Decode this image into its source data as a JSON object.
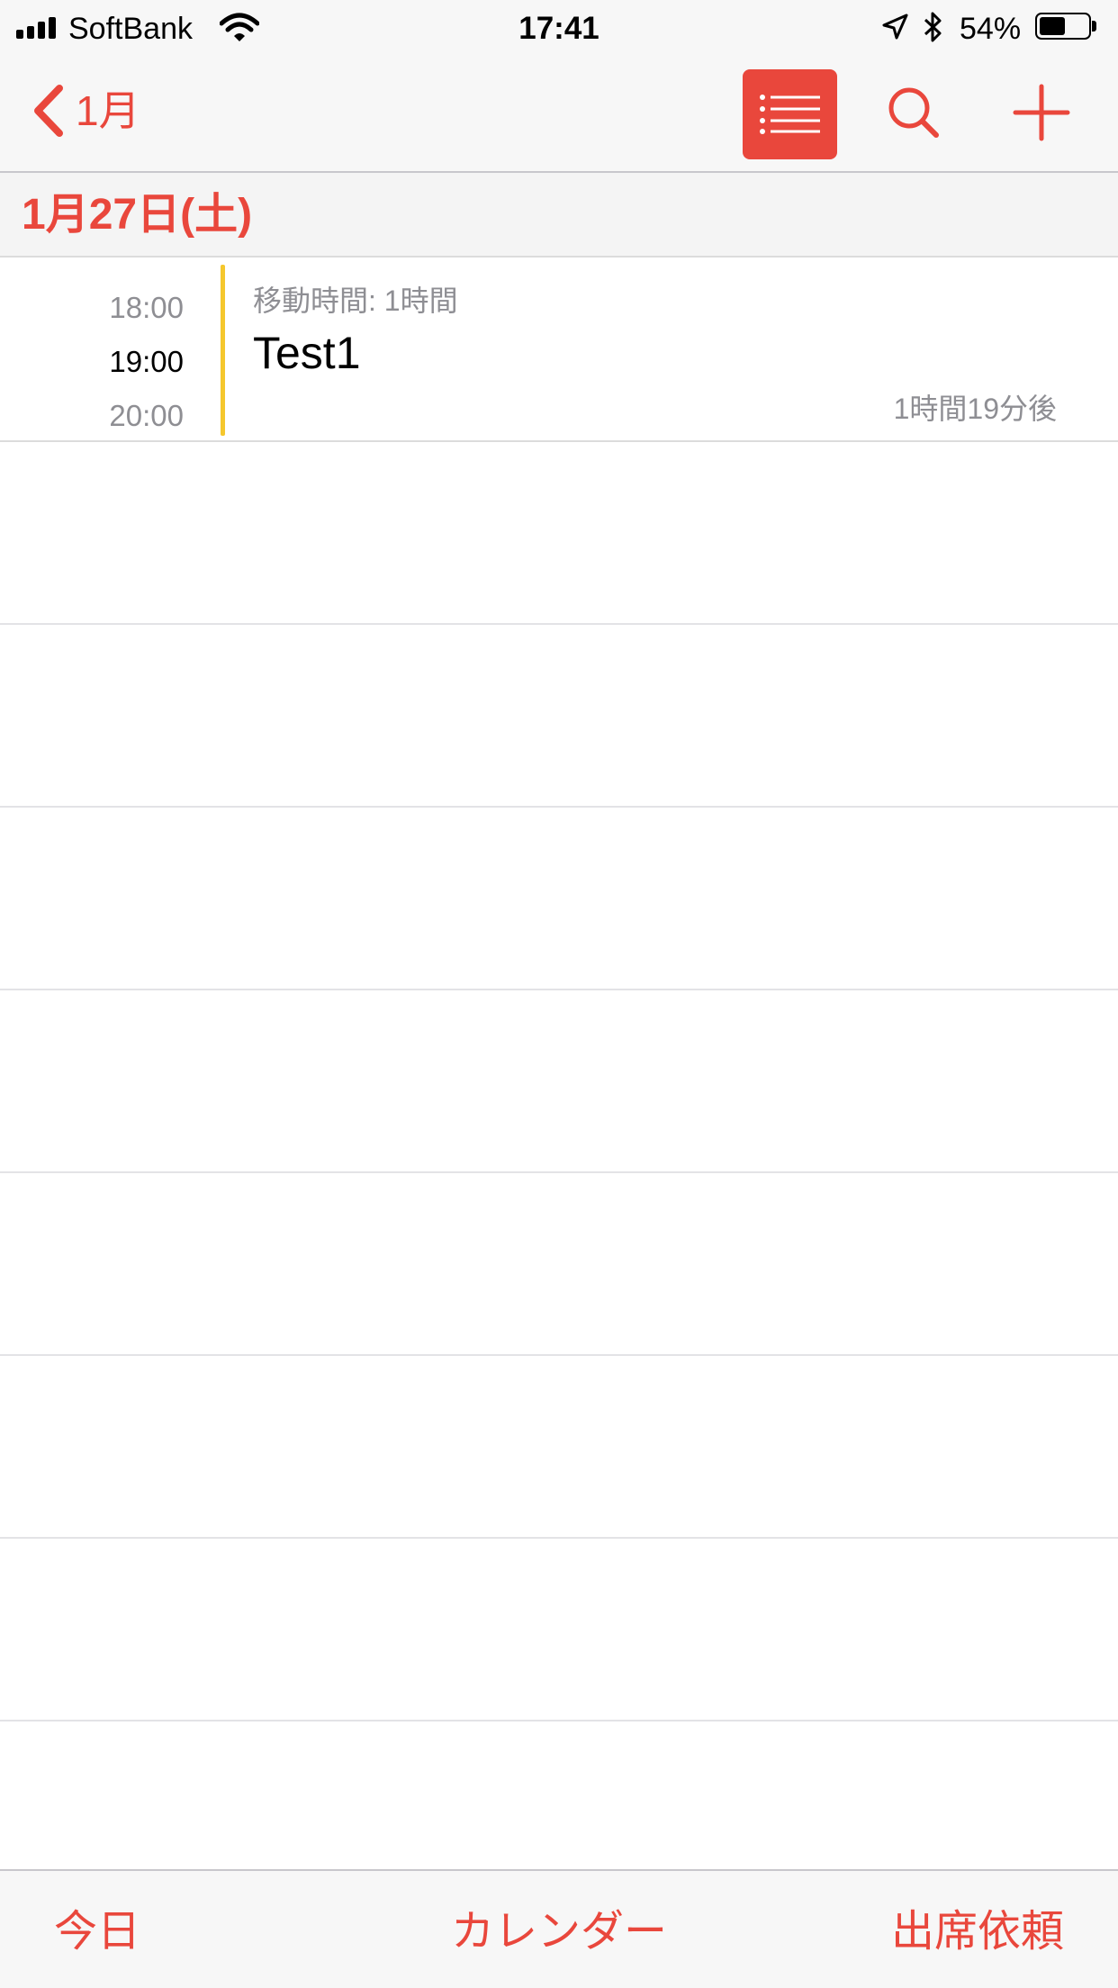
{
  "status_bar": {
    "carrier": "SoftBank",
    "time": "17:41",
    "battery_percent": "54%",
    "battery_level": 0.54,
    "icons": [
      "signal-icon",
      "wifi-icon",
      "location-icon",
      "bluetooth-icon",
      "battery-icon"
    ]
  },
  "nav": {
    "back_label": "1月",
    "icons": [
      "chevron-left-icon",
      "list-icon",
      "search-icon",
      "plus-icon"
    ]
  },
  "section": {
    "date": "1月27日(土)"
  },
  "event": {
    "travel_time_label": "18:00",
    "start_time": "19:00",
    "end_time": "20:00",
    "travel_time_text": "移動時間: 1時間",
    "title": "Test1",
    "relative_time": "1時間19分後"
  },
  "tab_bar": {
    "today": "今日",
    "calendars": "カレンダー",
    "inbox": "出席依頼"
  },
  "colors": {
    "accent": "#e9473c",
    "calendar_color": "#f5c72d",
    "secondary_text": "#8e8e93",
    "bar_background": "#f7f7f7"
  }
}
